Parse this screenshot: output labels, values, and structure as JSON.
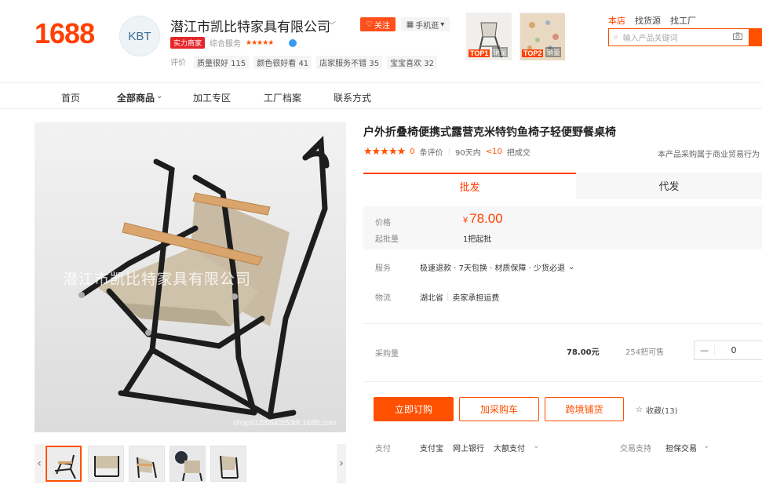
{
  "header": {
    "logo": "1688",
    "shop_avatar": "KBT",
    "shop_name": "潜江市凯比特家具有限公司",
    "follow_label": "关注",
    "mobile_label": "手机逛",
    "power_badge": "实力商家",
    "overall_label": "综合服务",
    "evaluation_label": "评价",
    "evaluations": [
      "质量很好 115",
      "颜色很好看 41",
      "店家服务不错 35",
      "宝宝喜欢 32"
    ],
    "top_items": [
      {
        "tag": "TOP1",
        "label": "销量"
      },
      {
        "tag": "TOP2",
        "label": "销量"
      }
    ],
    "search_tabs": [
      "本店",
      "找货源",
      "找工厂"
    ],
    "search_placeholder": "输入产品关键词"
  },
  "nav": {
    "items": [
      "首页",
      "全部商品",
      "加工专区",
      "工厂档案",
      "联系方式"
    ]
  },
  "gallery": {
    "watermark": "潜江市凯比特家具有限公司",
    "image_url_text": "shop9128t642t53t8.1688.com",
    "thumbnail_count": 5
  },
  "product": {
    "title": "户外折叠椅便携式露营克米特钓鱼椅子轻便野餐桌椅",
    "review_count": "0",
    "review_label": "条评价",
    "days_label": "90天内",
    "sold_count": "<10",
    "sold_label": "把成交",
    "business_note": "本产品采购属于商业贸易行为",
    "tabs": [
      "批发",
      "代发"
    ],
    "price_label": "价格",
    "currency": "¥",
    "price": "78.00",
    "moq_label": "起批量",
    "moq": "1把起批",
    "service_label": "服务",
    "service_value": "极速退款 · 7天包换 · 材质保障 · 少货必退",
    "logistics_label": "物流",
    "logistics_origin": "湖北省",
    "logistics_fee": "卖家承担运费",
    "qty_label": "采购量",
    "qty_total": "78.00元",
    "stock": "254把可售",
    "qty_value": "0",
    "minus": "—",
    "buy_now": "立即订购",
    "add_cart": "加采购车",
    "cross_border": "跨境铺货",
    "favorite": "收藏(13)",
    "pay_label": "支付",
    "pay_methods": [
      "支付宝",
      "网上银行",
      "大额支付"
    ],
    "trade_support_label": "交易支持",
    "trade_support_value": "担保交易"
  },
  "colors": {
    "brand": "#ff4000",
    "accent": "#ff5000"
  }
}
